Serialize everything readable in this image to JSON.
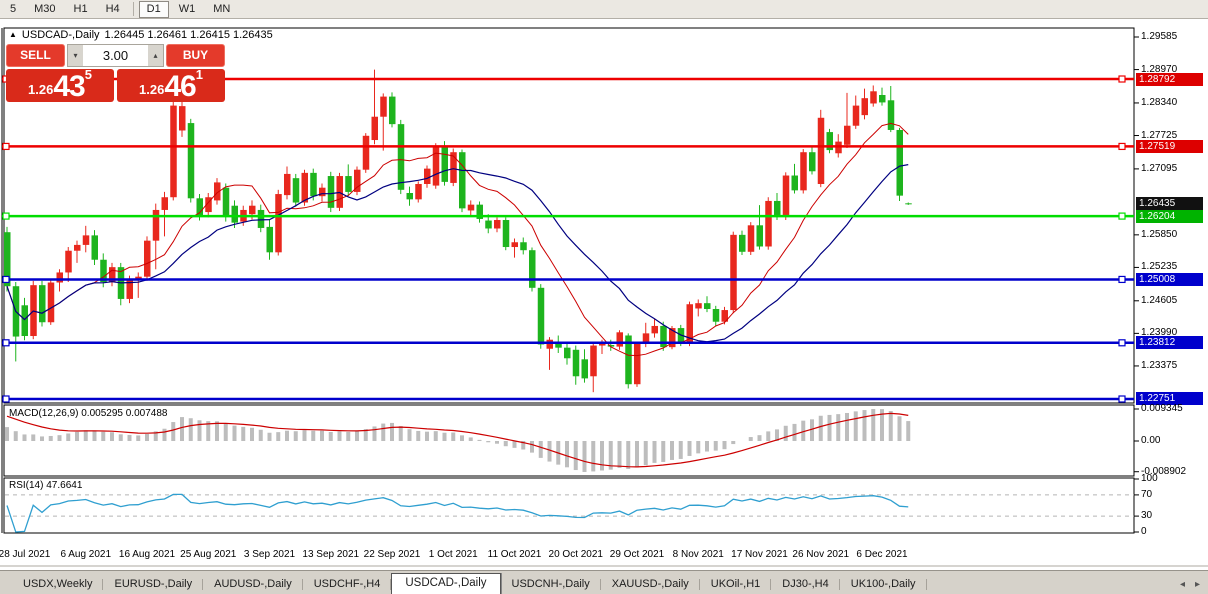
{
  "toolbar": {
    "timeframes": [
      "5",
      "M30",
      "H1",
      "H4",
      "D1",
      "W1",
      "MN"
    ],
    "active": "D1",
    "separator_after": "H4"
  },
  "chart": {
    "title": {
      "symbol": "USDCAD-,Daily",
      "ohlc": "1.26445 1.26461 1.26415 1.26435"
    }
  },
  "panel": {
    "sell_label": "SELL",
    "buy_label": "BUY",
    "volume": "3.00",
    "bid": {
      "prefix": "1.26",
      "big": "43",
      "sup": "5"
    },
    "ask": {
      "prefix": "1.26",
      "big": "46",
      "sup": "1"
    }
  },
  "indicators": {
    "macd": {
      "label": "MACD(12,26,9) 0.005295 0.007488",
      "params": [
        12,
        26,
        9
      ],
      "value_main": 0.005295,
      "value_signal": 0.007488,
      "axis_labels": [
        "0.009345",
        "0.00",
        "-0.008902"
      ]
    },
    "rsi": {
      "label": "RSI(14) 47.6641",
      "period": 14,
      "value": 47.6641,
      "levels": [
        70,
        30
      ],
      "axis_labels": [
        100,
        70,
        30,
        0
      ]
    }
  },
  "chart_data": {
    "type": "candlestick",
    "symbol": "USDCAD-,Daily",
    "title": "USDCAD-,Daily",
    "price_range_visible": [
      1.2264,
      1.2972
    ],
    "grid": false,
    "up_color": "#e8281e",
    "down_color": "#1eb41e",
    "price_axis_ticks": [
      1.29585,
      1.2897,
      1.2834,
      1.27725,
      1.27095,
      1.2585,
      1.25235,
      1.24605,
      1.2399,
      1.23375
    ],
    "badges": [
      {
        "text": "1.28792",
        "price": 1.28792,
        "bg": "#dd0000"
      },
      {
        "text": "1.27519",
        "price": 1.27519,
        "bg": "#dd0000"
      },
      {
        "text": "1.26435",
        "price": 1.26435,
        "bg": "#111111"
      },
      {
        "text": "1.26204",
        "price": 1.26204,
        "bg": "#00b300"
      },
      {
        "text": "1.25008",
        "price": 1.25008,
        "bg": "#0000cc"
      },
      {
        "text": "1.23812",
        "price": 1.23812,
        "bg": "#0000cc"
      },
      {
        "text": "1.22751",
        "price": 1.22751,
        "bg": "#0000cc"
      }
    ],
    "hlines": [
      {
        "price": 1.28792,
        "color": "#ee0000",
        "width": 2.5,
        "name": "resistance-1"
      },
      {
        "price": 1.27519,
        "color": "#ee0000",
        "width": 2.5,
        "name": "resistance-2"
      },
      {
        "price": 1.26204,
        "color": "#00dd00",
        "width": 2.5,
        "name": "support-green"
      },
      {
        "price": 1.25008,
        "color": "#0000cc",
        "width": 2.5,
        "name": "support-blue-1"
      },
      {
        "price": 1.23812,
        "color": "#0000cc",
        "width": 2.5,
        "name": "support-blue-2"
      },
      {
        "price": 1.22751,
        "color": "#0000cc",
        "width": 2.5,
        "name": "support-blue-3"
      }
    ],
    "moving_averages": [
      {
        "period": 10,
        "color": "#cc0000",
        "width": 1
      },
      {
        "period": 20,
        "color": "#000080",
        "width": 1.2
      }
    ],
    "x_dates": [
      "28 Jul 2021",
      "6 Aug 2021",
      "16 Aug 2021",
      "25 Aug 2021",
      "3 Sep 2021",
      "13 Sep 2021",
      "22 Sep 2021",
      "1 Oct 2021",
      "11 Oct 2021",
      "20 Oct 2021",
      "29 Oct 2021",
      "8 Nov 2021",
      "17 Nov 2021",
      "26 Nov 2021",
      "6 Dec 2021"
    ],
    "x_date_bar_indices": [
      2,
      9,
      16,
      23,
      30,
      37,
      44,
      51,
      58,
      65,
      72,
      79,
      86,
      93,
      100
    ],
    "current_price": 1.26435,
    "candles": [
      [
        1.259,
        1.26,
        1.2478,
        1.2488
      ],
      [
        1.2488,
        1.2496,
        1.2346,
        1.2393
      ],
      [
        1.2452,
        1.2466,
        1.2386,
        1.2394
      ],
      [
        1.2394,
        1.2498,
        1.2388,
        1.249
      ],
      [
        1.249,
        1.2498,
        1.2412,
        1.242
      ],
      [
        1.242,
        1.2502,
        1.2415,
        1.2495
      ],
      [
        1.2495,
        1.252,
        1.2478,
        1.2514
      ],
      [
        1.2514,
        1.2562,
        1.2496,
        1.2555
      ],
      [
        1.2555,
        1.2574,
        1.2532,
        1.2566
      ],
      [
        1.2566,
        1.2602,
        1.2552,
        1.2584
      ],
      [
        1.2584,
        1.2594,
        1.2528,
        1.2538
      ],
      [
        1.2538,
        1.255,
        1.2486,
        1.2496
      ],
      [
        1.2496,
        1.2532,
        1.2488,
        1.2524
      ],
      [
        1.2524,
        1.2532,
        1.2452,
        1.2464
      ],
      [
        1.2464,
        1.2508,
        1.2456,
        1.2502
      ],
      [
        1.2502,
        1.2514,
        1.2466,
        1.2506
      ],
      [
        1.2506,
        1.2582,
        1.2498,
        1.2574
      ],
      [
        1.2574,
        1.2644,
        1.252,
        1.2632
      ],
      [
        1.2632,
        1.2666,
        1.2582,
        1.2656
      ],
      [
        1.2656,
        1.2836,
        1.265,
        1.2829
      ],
      [
        1.2782,
        1.2844,
        1.277,
        1.2828
      ],
      [
        1.2796,
        1.2804,
        1.2646,
        1.2654
      ],
      [
        1.2654,
        1.2662,
        1.2612,
        1.2622
      ],
      [
        1.2628,
        1.2664,
        1.2618,
        1.2656
      ],
      [
        1.265,
        1.2692,
        1.2642,
        1.2684
      ],
      [
        1.2674,
        1.2682,
        1.261,
        1.262
      ],
      [
        1.264,
        1.265,
        1.2598,
        1.2608
      ],
      [
        1.261,
        1.264,
        1.2602,
        1.2632
      ],
      [
        1.2624,
        1.265,
        1.2614,
        1.264
      ],
      [
        1.2632,
        1.2642,
        1.259,
        1.2598
      ],
      [
        1.26,
        1.2614,
        1.2538,
        1.2552
      ],
      [
        1.2552,
        1.267,
        1.2546,
        1.2662
      ],
      [
        1.266,
        1.2714,
        1.2652,
        1.27
      ],
      [
        1.2692,
        1.27,
        1.2638,
        1.2646
      ],
      [
        1.2646,
        1.2708,
        1.264,
        1.2702
      ],
      [
        1.2702,
        1.271,
        1.265,
        1.2658
      ],
      [
        1.2658,
        1.2682,
        1.2648,
        1.2674
      ],
      [
        1.2696,
        1.2704,
        1.2628,
        1.2636
      ],
      [
        1.2636,
        1.2702,
        1.263,
        1.2696
      ],
      [
        1.2696,
        1.2718,
        1.2658,
        1.2666
      ],
      [
        1.2666,
        1.2714,
        1.266,
        1.2708
      ],
      [
        1.2708,
        1.2777,
        1.2702,
        1.2772
      ],
      [
        1.2764,
        1.2897,
        1.2756,
        1.2808
      ],
      [
        1.2808,
        1.2852,
        1.2744,
        1.2846
      ],
      [
        1.2846,
        1.2854,
        1.2788,
        1.2794
      ],
      [
        1.2794,
        1.2802,
        1.2662,
        1.267
      ],
      [
        1.2664,
        1.2676,
        1.264,
        1.2652
      ],
      [
        1.2652,
        1.2686,
        1.2646,
        1.2681
      ],
      [
        1.2681,
        1.2716,
        1.2674,
        1.271
      ],
      [
        1.2678,
        1.2758,
        1.2672,
        1.2752
      ],
      [
        1.2752,
        1.2762,
        1.2678,
        1.2685
      ],
      [
        1.2683,
        1.2748,
        1.2677,
        1.2741
      ],
      [
        1.2741,
        1.2746,
        1.2628,
        1.2635
      ],
      [
        1.2631,
        1.265,
        1.2622,
        1.2642
      ],
      [
        1.2642,
        1.2648,
        1.2608,
        1.2615
      ],
      [
        1.2612,
        1.2624,
        1.2588,
        1.2597
      ],
      [
        1.2597,
        1.2618,
        1.259,
        1.2613
      ],
      [
        1.2613,
        1.2618,
        1.2556,
        1.2562
      ],
      [
        1.2562,
        1.2578,
        1.2542,
        1.2571
      ],
      [
        1.2571,
        1.258,
        1.2548,
        1.2556
      ],
      [
        1.2556,
        1.2561,
        1.2478,
        1.2485
      ],
      [
        1.2485,
        1.2492,
        1.237,
        1.2378
      ],
      [
        1.237,
        1.2392,
        1.233,
        1.2387
      ],
      [
        1.2381,
        1.2395,
        1.2362,
        1.2372
      ],
      [
        1.2372,
        1.2383,
        1.234,
        1.2352
      ],
      [
        1.2368,
        1.2376,
        1.2302,
        1.2318
      ],
      [
        1.235,
        1.2369,
        1.2306,
        1.2314
      ],
      [
        1.2318,
        1.2381,
        1.2288,
        1.2376
      ],
      [
        1.2376,
        1.2387,
        1.236,
        1.2381
      ],
      [
        1.2377,
        1.2387,
        1.2366,
        1.2374
      ],
      [
        1.2374,
        1.2405,
        1.2368,
        1.2401
      ],
      [
        1.2395,
        1.2399,
        1.2295,
        1.2303
      ],
      [
        1.2303,
        1.2383,
        1.2298,
        1.2379
      ],
      [
        1.2379,
        1.2419,
        1.2373,
        1.2399
      ],
      [
        1.2399,
        1.2427,
        1.2391,
        1.2413
      ],
      [
        1.2413,
        1.2421,
        1.2366,
        1.2373
      ],
      [
        1.2373,
        1.2413,
        1.2369,
        1.2409
      ],
      [
        1.2409,
        1.2415,
        1.2375,
        1.2381
      ],
      [
        1.2381,
        1.2459,
        1.2375,
        1.2454
      ],
      [
        1.2446,
        1.2463,
        1.2431,
        1.2456
      ],
      [
        1.2456,
        1.2469,
        1.2439,
        1.2445
      ],
      [
        1.2445,
        1.2451,
        1.2413,
        1.2421
      ],
      [
        1.2421,
        1.2449,
        1.2416,
        1.2443
      ],
      [
        1.2443,
        1.2591,
        1.2437,
        1.2585
      ],
      [
        1.2585,
        1.2593,
        1.2547,
        1.2553
      ],
      [
        1.2553,
        1.2609,
        1.2547,
        1.2603
      ],
      [
        1.2603,
        1.2641,
        1.2557,
        1.2563
      ],
      [
        1.2563,
        1.2656,
        1.2557,
        1.2649
      ],
      [
        1.2649,
        1.2664,
        1.2613,
        1.2619
      ],
      [
        1.2619,
        1.2703,
        1.2613,
        1.2697
      ],
      [
        1.2697,
        1.2719,
        1.2663,
        1.2669
      ],
      [
        1.2669,
        1.2747,
        1.2663,
        1.2741
      ],
      [
        1.2741,
        1.2751,
        1.2699,
        1.2705
      ],
      [
        1.2681,
        1.2821,
        1.2675,
        1.2806
      ],
      [
        1.2779,
        1.2785,
        1.2739,
        1.2745
      ],
      [
        1.2739,
        1.2775,
        1.2731,
        1.2761
      ],
      [
        1.2755,
        1.2853,
        1.2749,
        1.2791
      ],
      [
        1.2791,
        1.2848,
        1.2785,
        1.2829
      ],
      [
        1.2811,
        1.2861,
        1.2803,
        1.2843
      ],
      [
        1.2833,
        1.2867,
        1.2827,
        1.2856
      ],
      [
        1.2849,
        1.2863,
        1.2829,
        1.2835
      ],
      [
        1.2839,
        1.2866,
        1.2779,
        1.2783
      ],
      [
        1.2783,
        1.2787,
        1.2649,
        1.2659
      ],
      [
        1.26445,
        1.26461,
        1.26415,
        1.26435
      ]
    ]
  },
  "tabs": {
    "items": [
      "USDX,Weekly",
      "EURUSD-,Daily",
      "AUDUSD-,Daily",
      "USDCHF-,H4",
      "USDCAD-,Daily",
      "USDCNH-,Daily",
      "XAUUSD-,Daily",
      "UKOil-,H1",
      "DJ30-,H4",
      "UK100-,Daily"
    ],
    "active": "USDCAD-,Daily",
    "scroll_left_icon": "◂",
    "scroll_right_icon": "▸"
  }
}
